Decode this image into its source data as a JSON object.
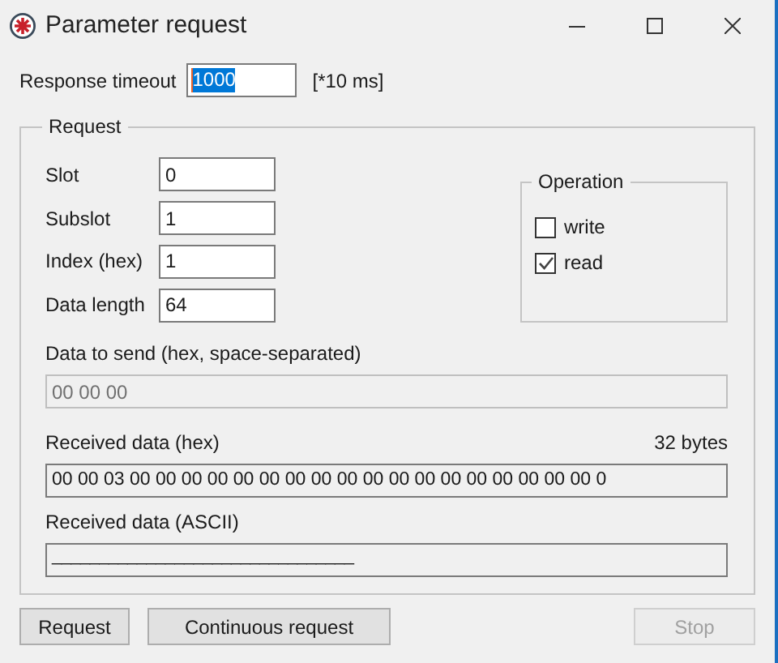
{
  "window": {
    "title": "Parameter request"
  },
  "response_timeout": {
    "label": "Response timeout",
    "value": "1000",
    "selected_text": true,
    "unit": "[*10 ms]"
  },
  "request": {
    "title": "Request",
    "fields": [
      {
        "label": "Slot",
        "value": "0"
      },
      {
        "label": "Subslot",
        "value": "1"
      },
      {
        "label": "Index (hex)",
        "value": "1"
      },
      {
        "label": "Data length",
        "value": "64"
      }
    ],
    "operation": {
      "title": "Operation",
      "options": [
        {
          "label": "write",
          "checked": false
        },
        {
          "label": "read",
          "checked": true
        }
      ]
    },
    "data_to_send": {
      "label": "Data to send (hex, space-separated)",
      "value": "00 00 00",
      "disabled": true
    },
    "received_hex": {
      "label": "Received data (hex)",
      "count": "32 bytes",
      "value": "00 00 03 00 00 00 00 00 00 00 00 00 00 00 00 00 00 00 00 00 00 0"
    },
    "received_ascii": {
      "label": "Received data (ASCII)",
      "value": "________________________________"
    }
  },
  "buttons": [
    {
      "label": "Request",
      "disabled": false
    },
    {
      "label": "Continuous request",
      "disabled": false
    },
    {
      "label": "Stop",
      "disabled": true
    }
  ]
}
